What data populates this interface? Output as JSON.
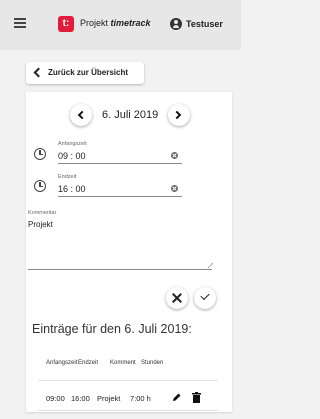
{
  "app": {
    "title_prefix": "Projekt",
    "title_name": "timetrack",
    "logo_letter": "t:",
    "user": "Testuser"
  },
  "back_button": {
    "label": "Zurück zur Übersicht"
  },
  "date_nav": {
    "date": "6. Juli 2019"
  },
  "form": {
    "start": {
      "label": "Anfangszeit",
      "value": "09 : 00"
    },
    "end": {
      "label": "Endzeit",
      "value": "16 : 00"
    },
    "comment": {
      "label": "Kommentar",
      "value": "Projekt"
    }
  },
  "entries": {
    "heading": "Einträge für den 6. Juli 2019:",
    "columns": [
      "Anfangszeit",
      "Endzeit",
      "Komment",
      "Stunden"
    ],
    "rows": [
      {
        "start": "09:00",
        "end": "16:00",
        "comment": "Projekt",
        "hours": "7:00 h"
      }
    ]
  },
  "colors": {
    "accent": "#e31b3a",
    "appbar": "#e7e7e7",
    "background": "#f2f2f2"
  },
  "icons": {
    "menu": "hamburger-icon",
    "user": "account-circle-icon",
    "clock": "clock-icon",
    "clear": "clear-icon",
    "edit": "pencil-icon",
    "delete": "trash-icon"
  }
}
